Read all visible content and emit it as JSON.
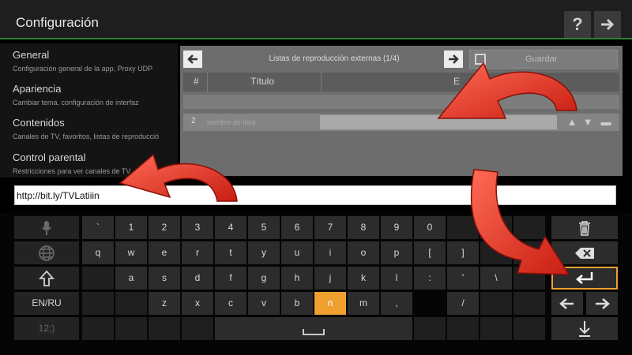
{
  "header": {
    "title": "Configuración",
    "help_label": "?",
    "forward_label": "➜"
  },
  "sidebar": {
    "items": [
      {
        "title": "General",
        "subtitle": "Configuración general de la app, Proxy UDP"
      },
      {
        "title": "Apariencia",
        "subtitle": "Cambiar tema, configuración de interfaz"
      },
      {
        "title": "Contenidos",
        "subtitle": "Canales de TV, favoritos, listas de reproducció"
      },
      {
        "title": "Control parental",
        "subtitle": "Restricciones para ver canales de TV"
      }
    ]
  },
  "dialog": {
    "title": "Listas de reproducción externas (1/4)",
    "save_label": "Guardar",
    "columns": [
      "#",
      "Título",
      "E"
    ],
    "row": {
      "number": "2",
      "name_placeholder": "nombre de lista"
    }
  },
  "input": {
    "value": "http://bit.ly/TVLatiiin"
  },
  "keyboard": {
    "row1": [
      "`",
      "1",
      "2",
      "3",
      "4",
      "5",
      "6",
      "7",
      "8",
      "9",
      "0"
    ],
    "row2": [
      "q",
      "w",
      "e",
      "r",
      "t",
      "y",
      "u",
      "i",
      "o",
      "p",
      "[",
      "]"
    ],
    "row3": [
      "a",
      "s",
      "d",
      "f",
      "g",
      "h",
      "j",
      "k",
      "l",
      ":",
      "'",
      "\\"
    ],
    "row4": [
      "z",
      "x",
      "c",
      "v",
      "b",
      "n",
      "m",
      ",",
      "/"
    ],
    "lang_label": "EN/RU",
    "sym_label": "12;)",
    "selected_key": "n"
  },
  "colors": {
    "accent": "#f0a030",
    "header_line": "#2e7d32",
    "arrow": "#e53020"
  }
}
